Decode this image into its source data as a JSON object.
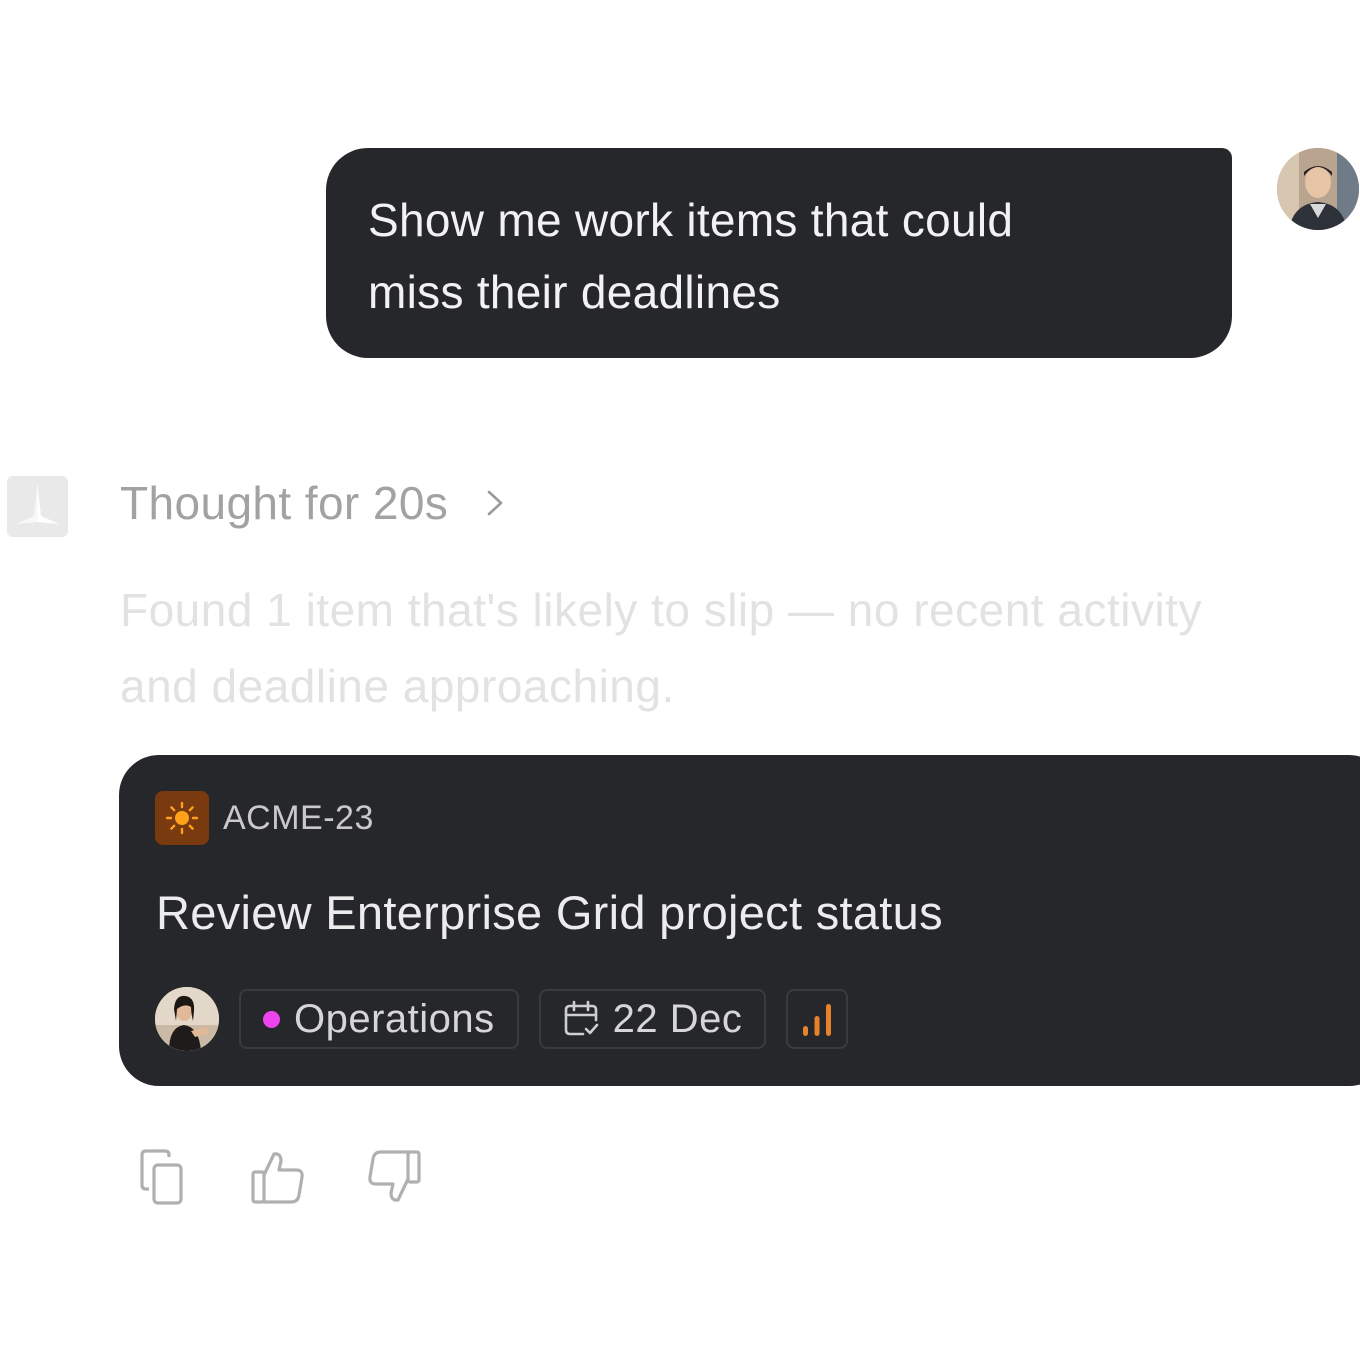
{
  "user_message": {
    "line1": "Show me work items that could",
    "line2": "miss their deadlines"
  },
  "assistant": {
    "thought_label": "Thought for 20s",
    "response_line1": "Found 1 item that's likely to slip — no recent activity",
    "response_line2": "and deadline approaching."
  },
  "work_item": {
    "id": "ACME-23",
    "title": "Review Enterprise Grid project status",
    "type_icon": "sun-icon",
    "team": "Operations",
    "team_color": "#ee44ee",
    "due_date": "22 Dec",
    "priority_icon": "signal-bars-icon",
    "priority_color": "#e8822a"
  },
  "actions": {
    "copy_icon": "copy-icon",
    "like_icon": "thumbs-up-icon",
    "dislike_icon": "thumbs-down-icon"
  }
}
